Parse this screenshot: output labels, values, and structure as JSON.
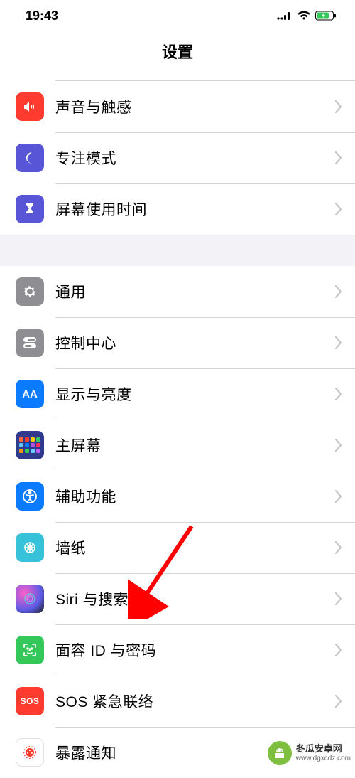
{
  "status_bar": {
    "time": "19:43"
  },
  "header": {
    "title": "设置"
  },
  "group1": {
    "items": [
      {
        "label": "声音与触感",
        "icon_bg": "#ff3b30"
      },
      {
        "label": "专注模式",
        "icon_bg": "#5856d6"
      },
      {
        "label": "屏幕使用时间",
        "icon_bg": "#5856d6"
      }
    ]
  },
  "group2": {
    "items": [
      {
        "label": "通用",
        "icon_bg": "#8e8e93"
      },
      {
        "label": "控制中心",
        "icon_bg": "#8e8e93"
      },
      {
        "label": "显示与亮度",
        "icon_bg": "#0a7aff"
      },
      {
        "label": "主屏幕",
        "icon_bg": "#2f3a8f"
      },
      {
        "label": "辅助功能",
        "icon_bg": "#0a7aff"
      },
      {
        "label": "墙纸",
        "icon_bg": "#37c2d9"
      },
      {
        "label": "Siri 与搜索",
        "icon_bg": "#1c1c1e"
      },
      {
        "label": "面容 ID 与密码",
        "icon_bg": "#34c759"
      },
      {
        "label": "SOS 紧急联络",
        "icon_bg": "#ff3b30"
      },
      {
        "label": "暴露通知",
        "icon_bg": "#ffffff"
      }
    ]
  },
  "watermark": {
    "line1": "冬瓜安卓网",
    "line2": "www.dgxcdz.com"
  }
}
